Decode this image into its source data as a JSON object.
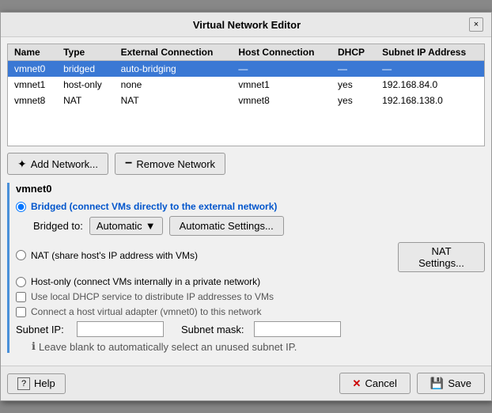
{
  "dialog": {
    "title": "Virtual Network Editor",
    "close_label": "×"
  },
  "table": {
    "columns": [
      "Name",
      "Type",
      "External Connection",
      "Host Connection",
      "DHCP",
      "Subnet IP Address"
    ],
    "rows": [
      {
        "name": "vmnet0",
        "type": "bridged",
        "external": "auto-bridging",
        "host": "—",
        "dhcp": "—",
        "subnet": "—",
        "selected": true
      },
      {
        "name": "vmnet1",
        "type": "host-only",
        "external": "none",
        "host": "vmnet1",
        "dhcp": "yes",
        "subnet": "192.168.84.0",
        "selected": false
      },
      {
        "name": "vmnet8",
        "type": "NAT",
        "external": "NAT",
        "host": "vmnet8",
        "dhcp": "yes",
        "subnet": "192.168.138.0",
        "selected": false
      }
    ]
  },
  "buttons": {
    "add_network": "Add Network...",
    "remove_network": "Remove Network"
  },
  "network_section": {
    "label": "vmnet0",
    "bridged_label": "Bridged (connect VMs directly to the external network)",
    "bridged_to_label": "Bridged to:",
    "bridged_to_value": "Automatic",
    "automatic_settings": "Automatic Settings...",
    "nat_label": "NAT (share host's IP address with VMs)",
    "nat_settings": "NAT Settings...",
    "host_only_label": "Host-only (connect VMs internally in a private network)",
    "dhcp_label": "Use local DHCP service to distribute IP addresses to VMs",
    "host_adapter_label": "Connect a host virtual adapter (vmnet0) to this network",
    "subnet_ip_label": "Subnet IP:",
    "subnet_ip_value": ". . .",
    "subnet_mask_label": "Subnet mask:",
    "subnet_mask_value": ". . .",
    "subnet_hint": "Leave blank to automatically select an unused subnet IP.",
    "hint_icon": "ℹ"
  },
  "footer": {
    "help_label": "Help",
    "cancel_label": "Cancel",
    "save_label": "Save"
  }
}
